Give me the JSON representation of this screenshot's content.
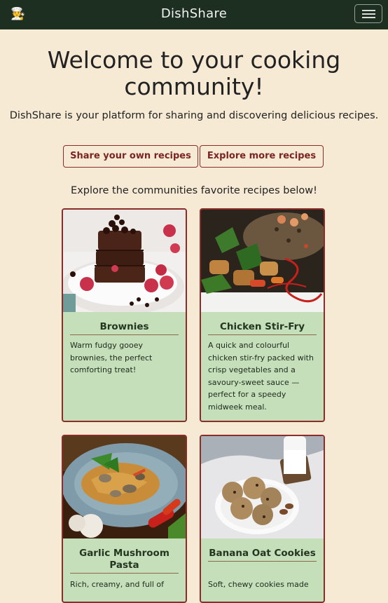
{
  "navbar": {
    "logo_icon": "chef-emoji",
    "title": "DishShare",
    "menu_icon": "hamburger-icon"
  },
  "hero": {
    "title": "Welcome to your cooking community!",
    "subtitle": "DishShare is your platform for sharing and discovering delicious recipes."
  },
  "buttons": {
    "share": "Share your own recipes",
    "explore": "Explore more recipes"
  },
  "explore_heading": "Explore the communities favorite recipes below!",
  "recipes": [
    {
      "title": "Brownies",
      "description": "Warm fudgy gooey brownies, the perfect comforting treat!"
    },
    {
      "title": "Chicken Stir-Fry",
      "description": "A quick and colourful chicken stir-fry packed with crisp vegetables and a savoury-sweet sauce — perfect for a speedy midweek meal."
    },
    {
      "title": "Garlic Mushroom Pasta",
      "description": "Rich, creamy, and full of"
    },
    {
      "title": "Banana Oat Cookies",
      "description": "Soft, chewy cookies made"
    }
  ],
  "colors": {
    "background": "#f7ead5",
    "navbar": "#1d2f21",
    "card_background": "#c5dfbb",
    "accent": "#8a2d2a"
  }
}
